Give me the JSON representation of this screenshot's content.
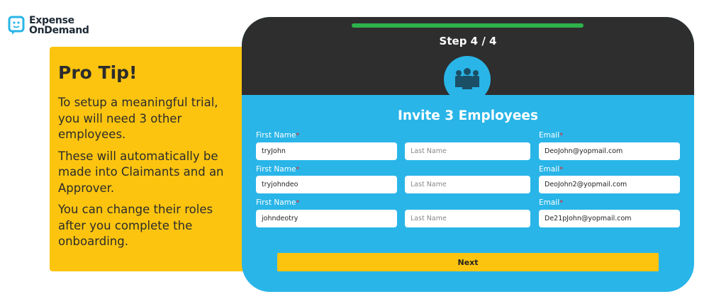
{
  "brand": {
    "line1": "Expense",
    "line2": "OnDemand",
    "color": "#29b5e8"
  },
  "tip": {
    "title": "Pro Tip!",
    "paragraphs": [
      "To setup a meaningful trial, you will need 3 other employees.",
      "These will automatically be made into Claimants and an Approver.",
      "You can change their roles after you complete the onboarding."
    ]
  },
  "wizard": {
    "step_label": "Step 4 / 4",
    "progress": 1.0,
    "title": "Invite 3 Employees",
    "labels": {
      "first_name": "First Name",
      "email": "Email",
      "required_marker": "*"
    },
    "rows": [
      {
        "first_name": "tryJohn",
        "last_name_placeholder": "Last Name",
        "email": "DeoJohn@yopmail.com"
      },
      {
        "first_name": "tryjohndeo",
        "last_name_placeholder": "Last Name",
        "email": "DeoJohn2@yopmail.com"
      },
      {
        "first_name": "johndeotry",
        "last_name_placeholder": "Last Name",
        "email": "De21pJohn@yopmail.com"
      }
    ],
    "next_label": "Next"
  },
  "colors": {
    "accent": "#29b5e8",
    "tip_bg": "#fcc40f",
    "header_bg": "#2e2e2e",
    "progress": "#2db34a",
    "required": "#e8262a"
  }
}
